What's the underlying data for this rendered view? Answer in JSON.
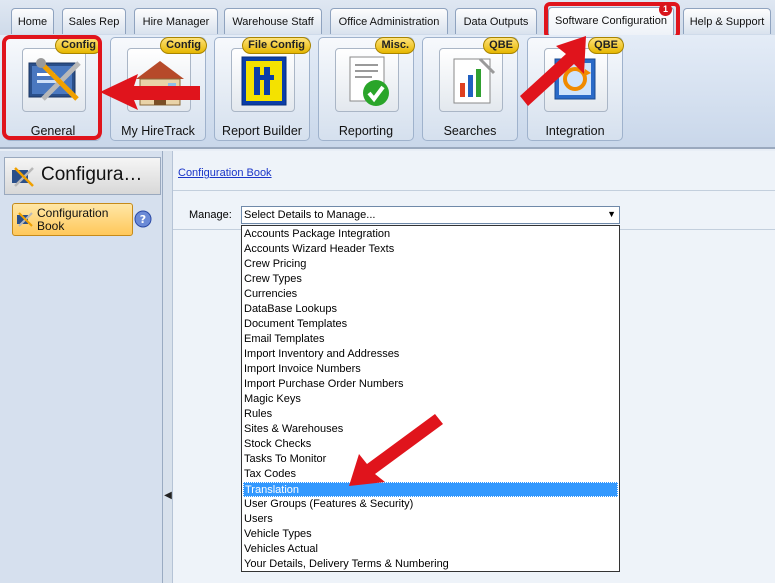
{
  "tabs": [
    {
      "label": "Home"
    },
    {
      "label": "Sales Rep"
    },
    {
      "label": "Hire Manager"
    },
    {
      "label": "Warehouse Staff"
    },
    {
      "label": "Office Administration"
    },
    {
      "label": "Data Outputs"
    },
    {
      "label": "Software Configuration",
      "badge": "1"
    },
    {
      "label": "Help & Support"
    }
  ],
  "ribbon": [
    {
      "label": "General",
      "tag": "Config"
    },
    {
      "label": "My HireTrack",
      "tag": "Config"
    },
    {
      "label": "Report Builder",
      "tag": "File Config"
    },
    {
      "label": "Reporting",
      "tag": "Misc."
    },
    {
      "label": "Searches",
      "tag": "QBE"
    },
    {
      "label": "Integration",
      "tag": "QBE"
    }
  ],
  "left_pane": {
    "title": "Configura…",
    "item_label": "Configuration Book"
  },
  "main": {
    "breadcrumb": "Configuration Book",
    "manage_label": "Manage:",
    "select_value": "Select Details to Manage...",
    "options": [
      "Accounts Package Integration",
      "Accounts Wizard Header Texts",
      "Crew Pricing",
      "Crew Types",
      "Currencies",
      "DataBase Lookups",
      "Document Templates",
      "Email Templates",
      "Import Inventory and Addresses",
      "Import Invoice Numbers",
      "Import Purchase Order Numbers",
      "Magic Keys",
      "Rules",
      "Sites & Warehouses",
      "Stock Checks",
      "Tasks To Monitor",
      "Tax Codes",
      "Translation",
      "User Groups (Features & Security)",
      "Users",
      "Vehicle Types",
      "Vehicles Actual",
      "Your Details, Delivery Terms & Numbering"
    ],
    "selected_option": "Translation"
  },
  "colors": {
    "highlight": "#e0141c",
    "selection": "#3399ff",
    "link": "#1a35c8",
    "tag": "#ffd43b"
  }
}
